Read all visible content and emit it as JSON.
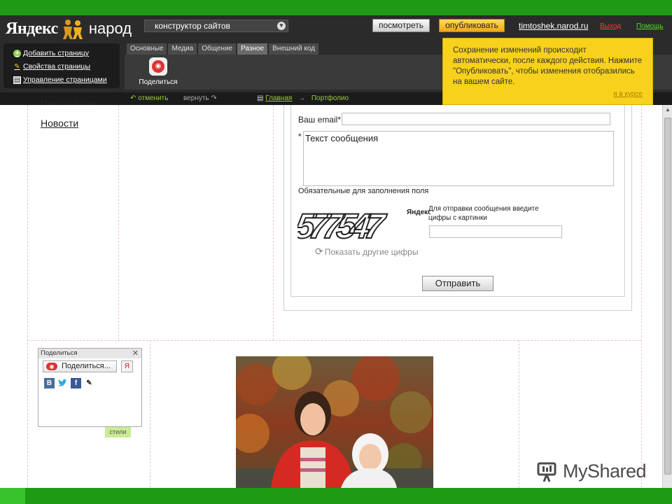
{
  "header": {
    "logo_left": "Яндекс",
    "logo_right": "народ",
    "site_selector": "конструктор сайтов",
    "view_button": "посмотреть",
    "publish_button": "опубликовать",
    "site_link": "timtoshek.narod.ru",
    "exit_link": "Выход",
    "help_link": "Помощь"
  },
  "left_panel": {
    "items": [
      {
        "label": "Добавить страницу",
        "icon": "add-icon"
      },
      {
        "label": "Свойства страницы",
        "icon": "pencil-icon"
      },
      {
        "label": "Управление страницами",
        "icon": "pages-icon"
      }
    ]
  },
  "tabs": [
    {
      "label": "Основные"
    },
    {
      "label": "Медиа"
    },
    {
      "label": "Общение"
    },
    {
      "label": "Разное",
      "active": true
    },
    {
      "label": "Внешний код"
    }
  ],
  "tool": {
    "share_label": "Поделиться"
  },
  "toolbar2": {
    "undo": "отменить",
    "redo": "вернуть",
    "crumb_home": "Главная",
    "crumb_current": "Портфолио"
  },
  "tooltip": {
    "text": "Сохранение изменений происходит автоматически, после каждого действия. Нажмите \"Опубликовать\", чтобы изменения отобразились на вашем сайте.",
    "link": "я в курсе"
  },
  "nav": {
    "portfolio": "Портфолио",
    "news": "Новости"
  },
  "form": {
    "email_label": "Ваш email*",
    "message_star": "*",
    "message_placeholder": "Текст сообщения",
    "required_note": "Обязательные для заполнения поля",
    "captcha_digits": "577547",
    "captcha_brand": "Яндекс",
    "captcha_hint": "Для отправки сообщения введите цифры с картинки",
    "other_digits": "Показать другие цифры",
    "submit": "Отправить"
  },
  "share_widget": {
    "title": "Поделиться",
    "button": "Поделиться...",
    "networks": [
      {
        "label": "В",
        "icon": "vk-icon"
      },
      {
        "label": "t",
        "icon": "twitter-icon"
      },
      {
        "label": "f",
        "icon": "facebook-icon"
      },
      {
        "label": "✎",
        "icon": "yandex-icon"
      }
    ],
    "styles_tag": "стили"
  },
  "watermark": {
    "text": "MyShared"
  },
  "colors": {
    "frame_green": "#1f9a14",
    "header_dark": "#2b2b2b",
    "publish_orange": "#f1a716",
    "tooltip_yellow": "#f7d11b",
    "link_green": "#9bcc3a"
  }
}
